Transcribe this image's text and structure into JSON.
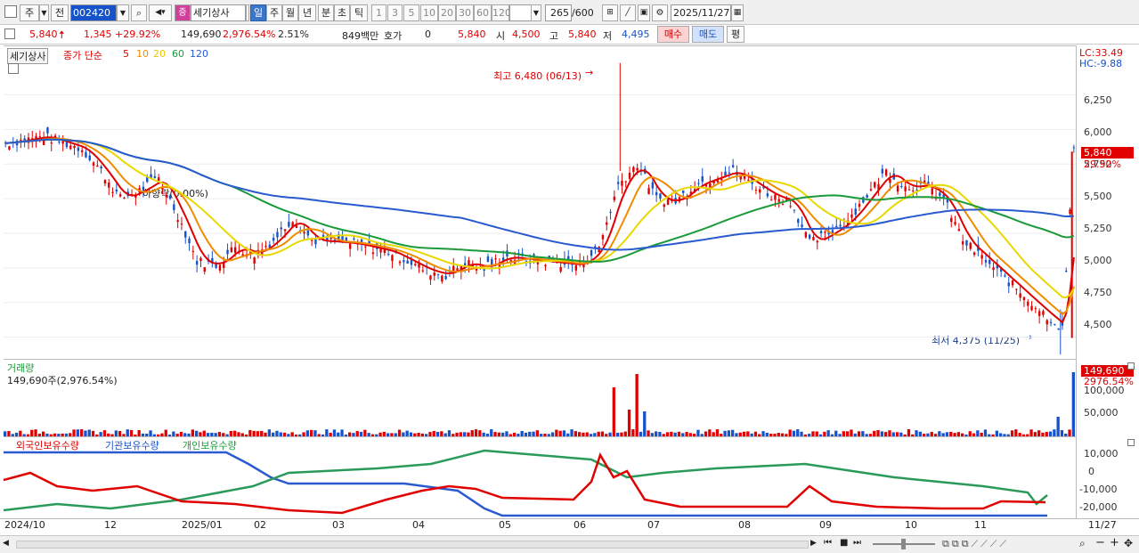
{
  "toolbar": {
    "market": "주",
    "prev": "전",
    "code": "002420",
    "name": "세기상사",
    "btn_icon_search": "",
    "periods": [
      "일",
      "주",
      "월",
      "년",
      "분",
      "초",
      "틱"
    ],
    "selected_period": "일",
    "ranges": [
      "1",
      "3",
      "5",
      "10",
      "20",
      "30",
      "60",
      "120"
    ],
    "count_display": "265",
    "count_total": "/600",
    "date": "2025/11/27"
  },
  "quote": {
    "price": "5,840",
    "change": "1,345",
    "change_pct": "+29.92%",
    "volume": "149,690",
    "volume_pct": "2,976.54%",
    "turnover_pct": "2.51%",
    "amount": "849백만",
    "hoga_label": "호가",
    "hoga_value": "0",
    "hoga_price": "5,840",
    "open_label": "시",
    "open": "4,500",
    "high_label": "고",
    "high": "5,840",
    "low_label": "저",
    "low": "4,495",
    "buy": "매수",
    "sell": "매도",
    "eval": "평"
  },
  "price_panel": {
    "stock_label": "세기상사",
    "ma_label": "종가 단순",
    "ma_periods": [
      "5",
      "10",
      "20",
      "60",
      "120"
    ],
    "ma_colors": [
      "#e00000",
      "#f08c00",
      "#e8d800",
      "#1a9a3a",
      "#2a5ad0"
    ],
    "lc": "LC:33.49",
    "hc": "HC:-9.88",
    "high_annot": "최고 6,480 (06/13)",
    "low_annot": "최저 4,375 (11/25)",
    "mid_annot": "하향락(0.00%)",
    "cur_price": "5,840",
    "cur_pct": "29.92%",
    "yticks": [
      "6,250",
      "6,000",
      "5,750",
      "5,500",
      "5,250",
      "5,000",
      "4,750",
      "4,500"
    ]
  },
  "volume_panel": {
    "title": "거래량",
    "value": "149,690주(2,976.54%)",
    "cur": "149,690",
    "cur_pct": "2976.54%",
    "yticks": [
      "100,000",
      "50,000"
    ]
  },
  "holding_panel": {
    "foreign": "외국인보유수량",
    "inst": "기관보유수량",
    "indiv": "개인보유수량",
    "yticks": [
      "10,000",
      "0",
      "-10,000",
      "-20,000"
    ]
  },
  "xaxis": {
    "labels": [
      "2024/10",
      "12",
      "2025/01",
      "02",
      "03",
      "04",
      "05",
      "06",
      "07",
      "08",
      "09",
      "10",
      "11"
    ],
    "end": "11/27"
  },
  "chart_data": {
    "type": "candlestick",
    "series": [
      {
        "name": "5",
        "color": "#e00000"
      },
      {
        "name": "10",
        "color": "#f08c00"
      },
      {
        "name": "20",
        "color": "#e8d800"
      },
      {
        "name": "60",
        "color": "#1a9a3a"
      },
      {
        "name": "120",
        "color": "#2a5ad0"
      }
    ],
    "high": {
      "value": 6480,
      "date": "06/13"
    },
    "low": {
      "value": 4375,
      "date": "11/25"
    },
    "last": {
      "value": 5840,
      "change_pct": 29.92
    },
    "ylim": [
      4350,
      6600
    ]
  }
}
